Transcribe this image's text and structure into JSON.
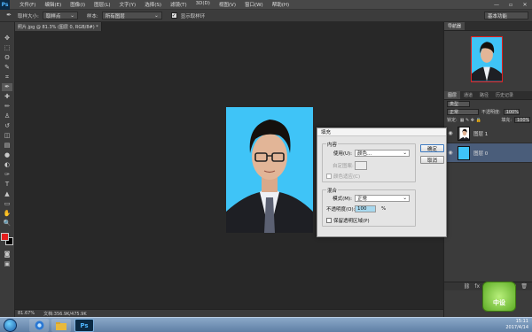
{
  "app": {
    "logo": "Ps"
  },
  "menu": {
    "items": [
      "文件(F)",
      "编辑(E)",
      "图像(I)",
      "图层(L)",
      "文字(Y)",
      "选择(S)",
      "滤镜(T)",
      "3D(D)",
      "视图(V)",
      "窗口(W)",
      "帮助(H)"
    ],
    "window_controls": [
      "—",
      "▫",
      "✕"
    ]
  },
  "options": {
    "tool_icon": "eyedropper-icon",
    "sample_size_label": "取样大小:",
    "sample_size_value": "取样点",
    "sample_label": "样本:",
    "sample_value": "所有图层",
    "show_ring_label": "显示取样环",
    "show_ring_checked": true,
    "workspace": "基本功能"
  },
  "document": {
    "tab_title": "照片.jpg @ 81.3% (图层 0, RGB/8#) *"
  },
  "toolbox": {
    "tools": [
      "move-icon",
      "marquee-icon",
      "lasso-icon",
      "quick-select-icon",
      "crop-icon",
      "eyedropper-icon",
      "healing-icon",
      "brush-icon",
      "stamp-icon",
      "history-brush-icon",
      "eraser-icon",
      "gradient-icon",
      "blur-icon",
      "dodge-icon",
      "pen-icon",
      "type-icon",
      "path-select-icon",
      "shape-icon",
      "hand-icon",
      "zoom-icon"
    ],
    "glyphs": [
      "✥",
      "⬚",
      "ʘ",
      "✎",
      "⌗",
      "✒",
      "✚",
      "✏",
      "♙",
      "↺",
      "◫",
      "▤",
      "●",
      "◐",
      "✑",
      "T",
      "▲",
      "▭",
      "✋",
      "🔍"
    ],
    "active_index": 5,
    "fg_color": "#e31d1d",
    "bg_color": "#000000"
  },
  "status": {
    "zoom": "81.67%",
    "doc_info": "文档:356.9K/475.9K"
  },
  "navigator": {
    "tabs": [
      "导航器"
    ]
  },
  "layers_panel": {
    "tabs": [
      "图层",
      "通道",
      "路径",
      "历史记录"
    ],
    "kind_label": "类型",
    "blend_mode": "正常",
    "opacity_label": "不透明度:",
    "opacity_value": "100%",
    "lock_label": "锁定:",
    "fill_label": "填充:",
    "fill_value": "100%",
    "layers": [
      {
        "name": "图层 1",
        "selected": false
      },
      {
        "name": "图层 0",
        "selected": true
      }
    ],
    "footer_icons": [
      "link-icon",
      "fx-icon",
      "mask-icon",
      "adjustment-icon",
      "folder-icon",
      "new-layer-icon",
      "trash-icon"
    ]
  },
  "fill_dialog": {
    "title": "填充",
    "contents_legend": "内容",
    "use_label": "使用(U):",
    "use_value": "颜色...",
    "custom_pattern_label": "自定图案:",
    "content_aware_label": "颜色适应(C)",
    "blending_legend": "混合",
    "mode_label": "模式(M):",
    "mode_value": "正常",
    "opacity_label": "不透明度(O):",
    "opacity_value": "100",
    "opacity_unit": "%",
    "preserve_label": "保留透明区域(P)",
    "ok_label": "确定",
    "cancel_label": "取消"
  },
  "taskbar": {
    "time": "15:11",
    "date": "2017/4/14"
  },
  "watermark": {
    "text": "中设"
  },
  "colors": {
    "photo_bg": "#3fc4f7",
    "accent_selection": "#4a5d7a",
    "menu_bg": "#484848"
  }
}
